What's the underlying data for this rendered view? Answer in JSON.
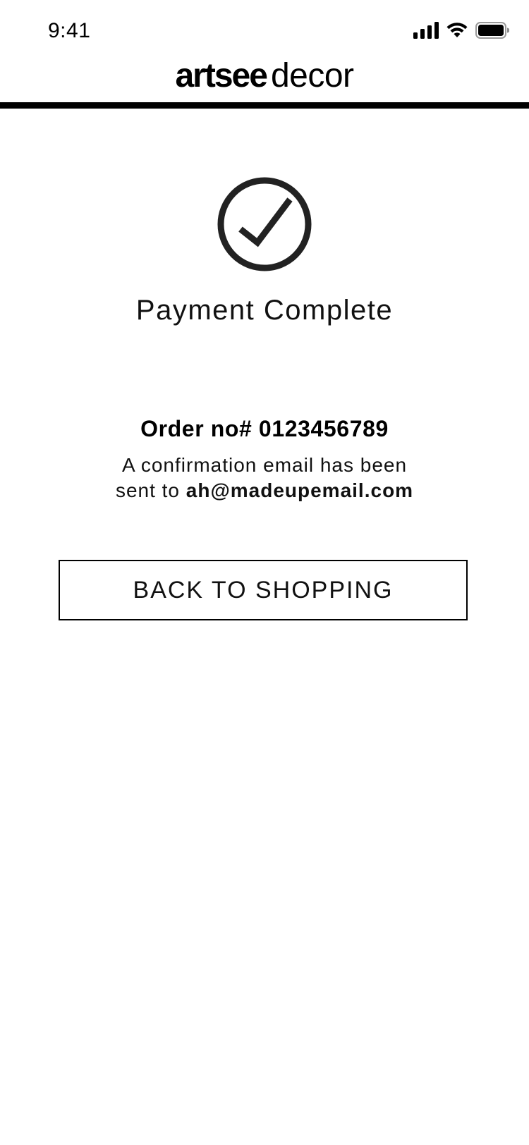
{
  "status_bar": {
    "time": "9:41",
    "icons": [
      "cellular-signal-icon",
      "wifi-icon",
      "battery-icon"
    ]
  },
  "header": {
    "logo_bold": "artsee",
    "logo_light": "decor"
  },
  "confirmation": {
    "icon": "checkmark-circle-icon",
    "title": "Payment Complete",
    "order_number": "Order no# 0123456789",
    "message_line1": "A confirmation email has been",
    "message_prefix": "sent to ",
    "email": "ah@madeupemail.com"
  },
  "actions": {
    "back_to_shopping_label": "BACK TO SHOPPING"
  },
  "colors": {
    "text": "#000000",
    "background": "#ffffff",
    "accent": "#1a1a1a"
  }
}
